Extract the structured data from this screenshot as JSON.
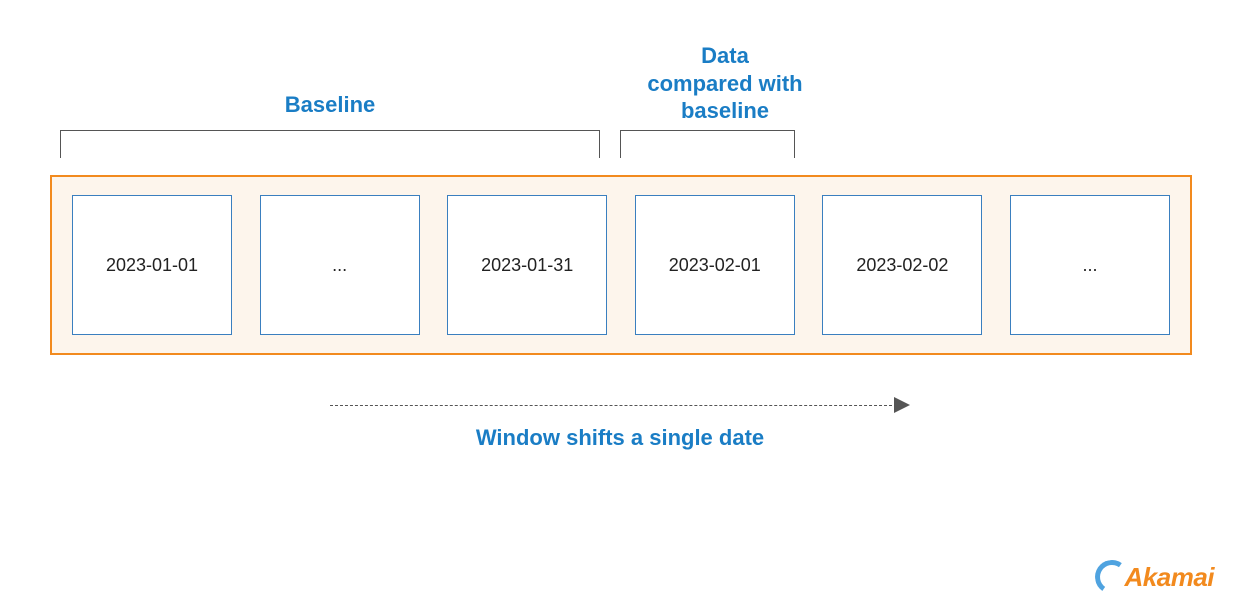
{
  "labels": {
    "baseline": "Baseline",
    "compare": "Data\ncompared with\nbaseline",
    "shift": "Window shifts a single date"
  },
  "cells": [
    "2023-01-01",
    "...",
    "2023-01-31",
    "2023-02-01",
    "2023-02-02",
    "..."
  ],
  "brand": "Akamai"
}
